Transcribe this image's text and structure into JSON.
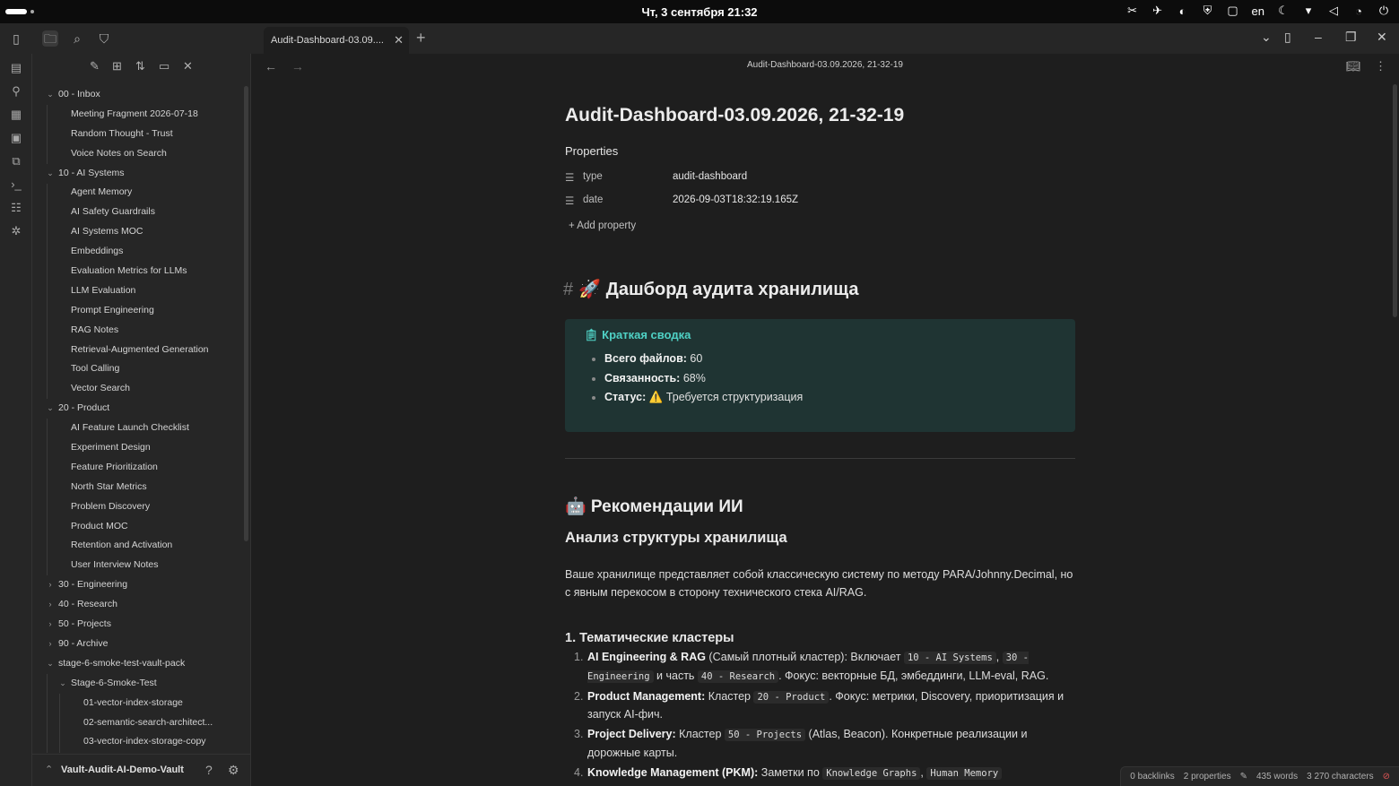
{
  "system_bar": {
    "clock": "Чт, 3 сентября  21:32",
    "tray": [
      "✂",
      "✈",
      "◐",
      "⛨",
      "▢",
      "en",
      "☾",
      "▾",
      "◁",
      "◔",
      "⏻"
    ]
  },
  "tabs": [
    {
      "label": "Audit-Dashboard-03.09...."
    }
  ],
  "sidebar": {
    "tree": [
      {
        "label": "00 - Inbox",
        "level": 0,
        "folder": true,
        "open": true
      },
      {
        "label": "Meeting Fragment 2026-07-18",
        "level": 1
      },
      {
        "label": "Random Thought - Trust",
        "level": 1
      },
      {
        "label": "Voice Notes on Search",
        "level": 1
      },
      {
        "label": "10 - AI Systems",
        "level": 0,
        "folder": true,
        "open": true
      },
      {
        "label": "Agent Memory",
        "level": 1
      },
      {
        "label": "AI Safety Guardrails",
        "level": 1
      },
      {
        "label": "AI Systems MOC",
        "level": 1
      },
      {
        "label": "Embeddings",
        "level": 1
      },
      {
        "label": "Evaluation Metrics for LLMs",
        "level": 1
      },
      {
        "label": "LLM Evaluation",
        "level": 1
      },
      {
        "label": "Prompt Engineering",
        "level": 1
      },
      {
        "label": "RAG Notes",
        "level": 1
      },
      {
        "label": "Retrieval-Augmented Generation",
        "level": 1
      },
      {
        "label": "Tool Calling",
        "level": 1
      },
      {
        "label": "Vector Search",
        "level": 1
      },
      {
        "label": "20 - Product",
        "level": 0,
        "folder": true,
        "open": true
      },
      {
        "label": "AI Feature Launch Checklist",
        "level": 1
      },
      {
        "label": "Experiment Design",
        "level": 1
      },
      {
        "label": "Feature Prioritization",
        "level": 1
      },
      {
        "label": "North Star Metrics",
        "level": 1
      },
      {
        "label": "Problem Discovery",
        "level": 1
      },
      {
        "label": "Product MOC",
        "level": 1
      },
      {
        "label": "Retention and Activation",
        "level": 1
      },
      {
        "label": "User Interview Notes",
        "level": 1
      },
      {
        "label": "30 - Engineering",
        "level": 0,
        "folder": true,
        "open": false
      },
      {
        "label": "40 - Research",
        "level": 0,
        "folder": true,
        "open": false
      },
      {
        "label": "50 - Projects",
        "level": 0,
        "folder": true,
        "open": false
      },
      {
        "label": "90 - Archive",
        "level": 0,
        "folder": true,
        "open": false
      },
      {
        "label": "stage-6-smoke-test-vault-pack",
        "level": 0,
        "folder": true,
        "open": true
      },
      {
        "label": "Stage-6-Smoke-Test",
        "level": 1,
        "folder": true,
        "open": true
      },
      {
        "label": "01-vector-index-storage",
        "level": 2
      },
      {
        "label": "02-semantic-search-architect...",
        "level": 2
      },
      {
        "label": "03-vector-index-storage-copy",
        "level": 2
      }
    ],
    "vault_name": "Vault-Audit-AI-Demo-Vault"
  },
  "editor": {
    "header_title": "Audit-Dashboard-03.09.2026, 21-32-19",
    "title": "Audit-Dashboard-03.09.2026, 21-32-19",
    "properties_label": "Properties",
    "properties": [
      {
        "key": "type",
        "value": "audit-dashboard"
      },
      {
        "key": "date",
        "value": "2026-09-03T18:32:19.165Z"
      }
    ],
    "add_property": "Add property",
    "heading1_hash": "#",
    "heading1": "🚀 Дашборд аудита хранилища",
    "callout": {
      "title": "Краткая сводка",
      "items": [
        {
          "label": "Всего файлов:",
          "value": "60"
        },
        {
          "label": "Связанность:",
          "value": "68%"
        },
        {
          "label": "Статус:",
          "value": "⚠️ Требуется структуризация"
        }
      ]
    },
    "heading2": "🤖 Рекомендации ИИ",
    "heading3": "Анализ структуры хранилища",
    "paragraph": "Ваше хранилище представляет собой классическую систему по методу PARA/Johnny.Decimal, но с явным перекосом в сторону технического стека AI/RAG.",
    "heading4": "1. Тематические кластеры",
    "list": [
      {
        "num": "1.",
        "bold": "AI Engineering & RAG",
        "t1": " (Самый плотный кластер): Включает ",
        "c1": "10 - AI Systems",
        "t2": ", ",
        "c2": "30 - Engineering",
        "t3": " и часть ",
        "c3": "40 - Research",
        "t4": ". Фокус: векторные БД, эмбеддинги, LLM-eval, RAG."
      },
      {
        "num": "2.",
        "bold": "Product Management:",
        "t1": " Кластер ",
        "c1": "20 - Product",
        "t2": ". Фокус: метрики, Discovery, приоритизация и запуск AI-фич.",
        "c2": "",
        "t3": "",
        "c3": "",
        "t4": ""
      },
      {
        "num": "3.",
        "bold": "Project Delivery:",
        "t1": " Кластер ",
        "c1": "50 - Projects",
        "t2": " (Atlas, Beacon). Конкретные реализации и дорожные карты.",
        "c2": "",
        "t3": "",
        "c3": "",
        "t4": ""
      },
      {
        "num": "4.",
        "bold": "Knowledge Management (PKM):",
        "t1": " Заметки по ",
        "c1": "Knowledge Graphs",
        "t2": ", ",
        "c2": "Human Memory",
        "t3": "",
        "c3": "",
        "t4": ""
      }
    ]
  },
  "status_bar": {
    "backlinks": "0 backlinks",
    "properties": "2 properties",
    "words": "435 words",
    "characters": "3 270 characters"
  },
  "colors": {
    "background": "#1e1e1e",
    "panel": "#262626",
    "callout_bg": "#1f3433",
    "callout_accent": "#4fd1c5"
  }
}
